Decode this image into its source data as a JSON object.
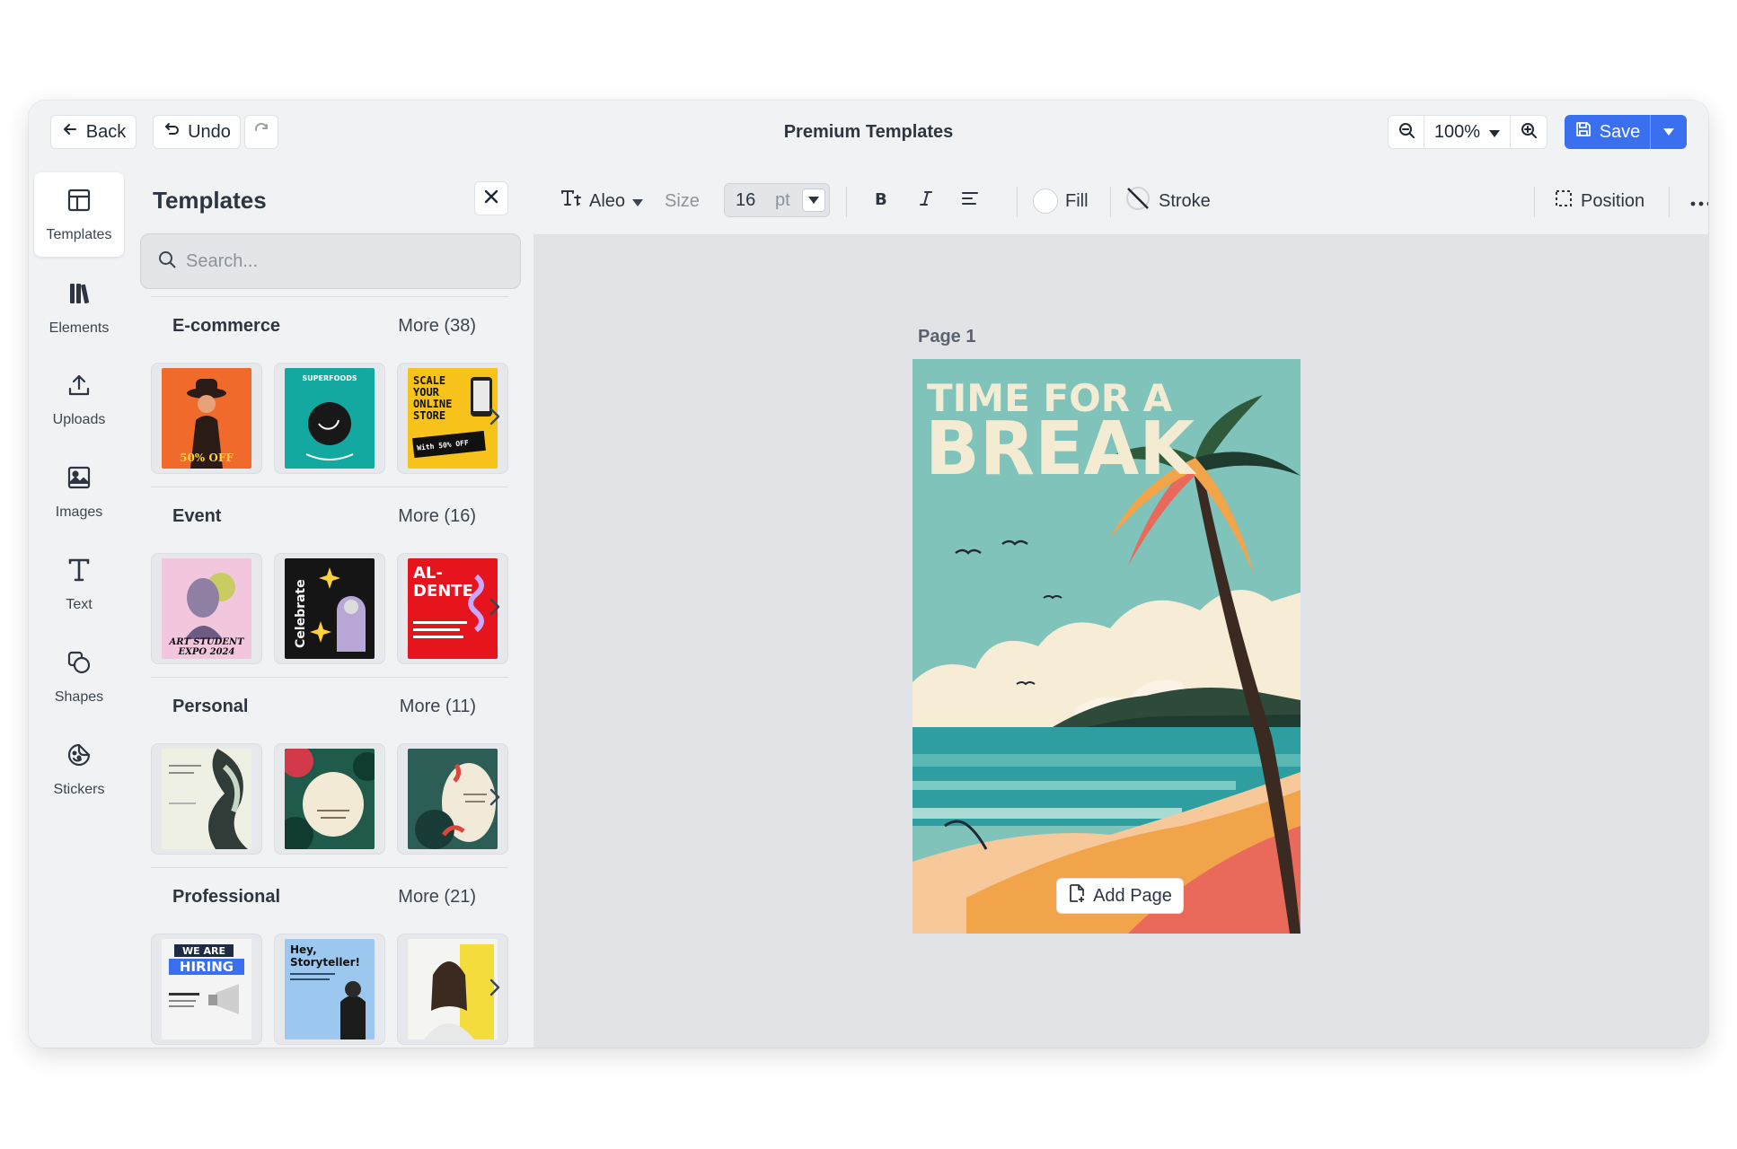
{
  "header": {
    "back_label": "Back",
    "undo_label": "Undo",
    "title": "Premium Templates",
    "zoom": "100%",
    "save_label": "Save"
  },
  "rail": {
    "items": [
      {
        "label": "Templates",
        "icon": "layout-icon"
      },
      {
        "label": "Elements",
        "icon": "library-icon"
      },
      {
        "label": "Uploads",
        "icon": "upload-icon"
      },
      {
        "label": "Images",
        "icon": "image-icon"
      },
      {
        "label": "Text",
        "icon": "text-icon"
      },
      {
        "label": "Shapes",
        "icon": "shapes-icon"
      },
      {
        "label": "Stickers",
        "icon": "sticker-icon"
      }
    ]
  },
  "panel": {
    "title": "Templates",
    "search_placeholder": "Search...",
    "sections": [
      {
        "name": "E-commerce",
        "more": "More (38)"
      },
      {
        "name": "Event",
        "more": "More (16)"
      },
      {
        "name": "Personal",
        "more": "More (11)"
      },
      {
        "name": "Professional",
        "more": "More (21)"
      }
    ],
    "thumb_text": {
      "scale": [
        "SCALE",
        "YOUR",
        "ONLINE",
        "STORE"
      ],
      "scale_offer": "With 50% OFF",
      "superfoods": "SUPERFOODS",
      "discount": "50% OFF",
      "art": [
        "ART STUDENT",
        "EXPO 2024"
      ],
      "celebrate": "Celebrate",
      "aldente": [
        "AL-",
        "DENTE"
      ],
      "hiring": [
        "WE ARE",
        "HIRING"
      ],
      "storyteller": [
        "Hey,",
        "Storyteller!"
      ]
    }
  },
  "toolbar": {
    "font": "Aleo",
    "size_label": "Size",
    "size_value": "16",
    "size_unit": "pt",
    "fill_label": "Fill",
    "stroke_label": "Stroke",
    "position_label": "Position"
  },
  "canvas": {
    "page_label": "Page  1",
    "poster_line1": "TIME FOR A",
    "poster_line2": "BREAK",
    "add_page_label": "Add Page"
  },
  "colors": {
    "accent": "#3a6ff0",
    "poster_sky": "#7fc3bb",
    "poster_title": "#f3ecd3",
    "poster_sand": "#f6c89a",
    "poster_sea": "#2f9ea0"
  }
}
